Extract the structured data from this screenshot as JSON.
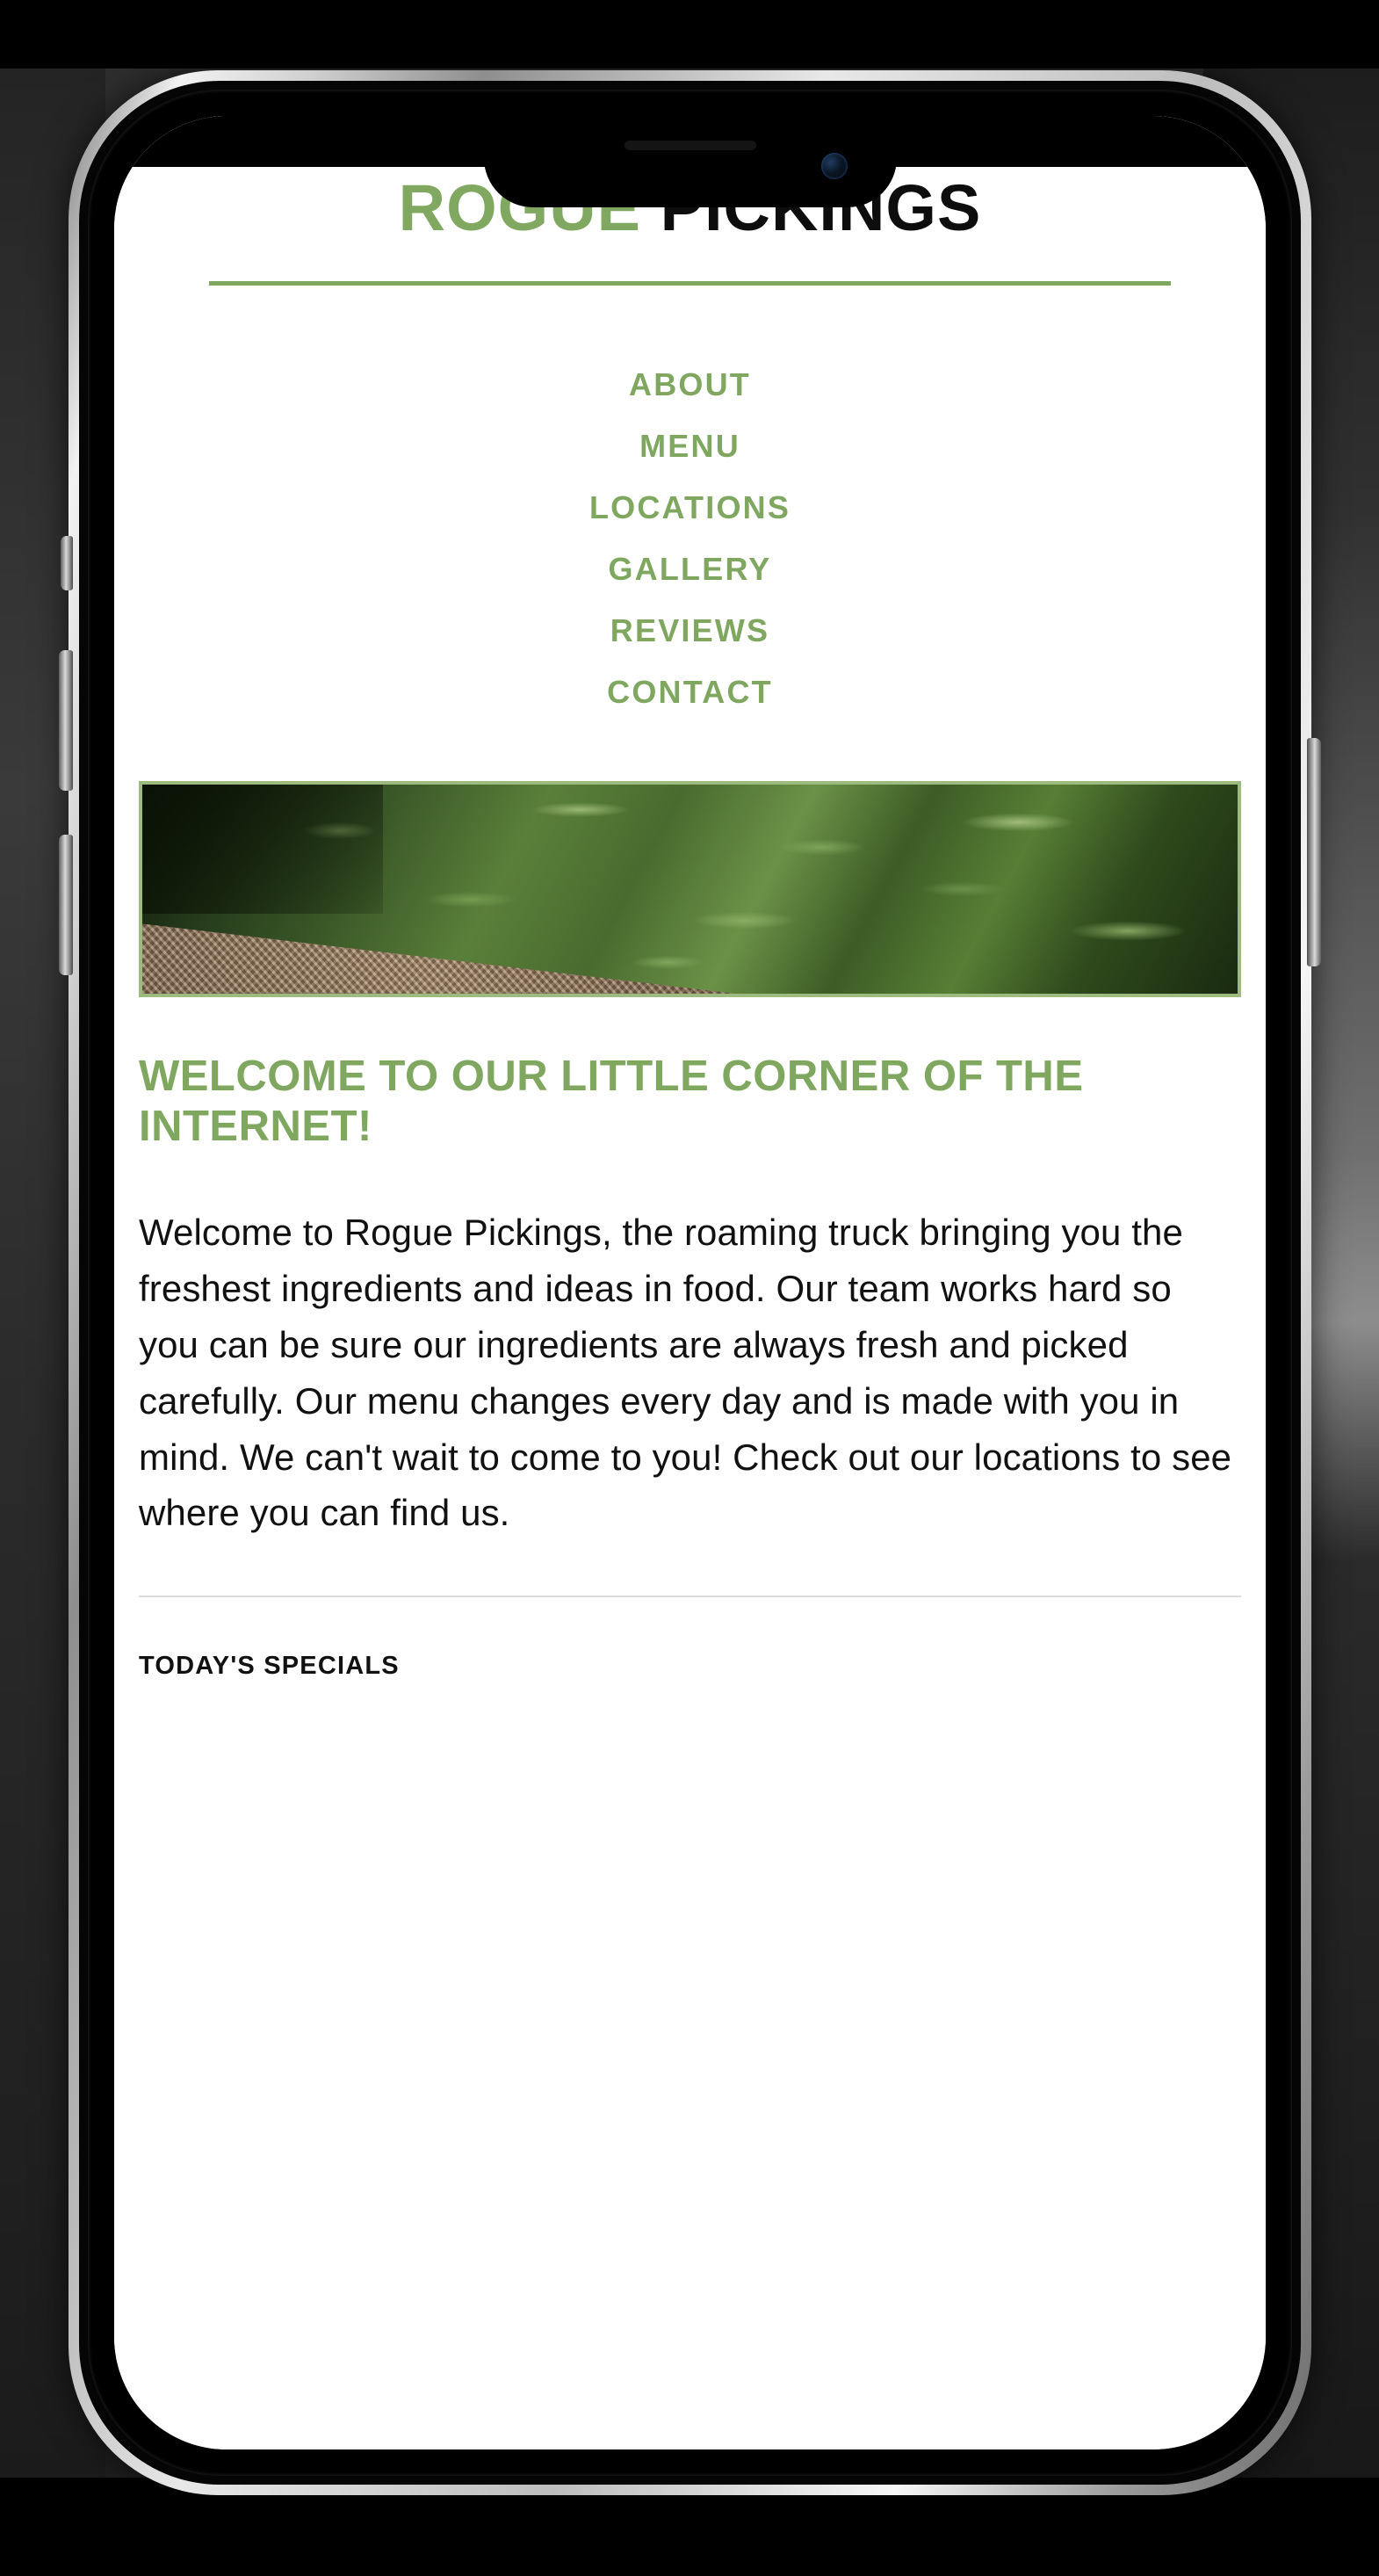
{
  "device": {
    "type": "smartphone-mockup",
    "buttons": [
      "silent-switch",
      "volume-up",
      "volume-down",
      "power"
    ]
  },
  "site": {
    "title_part_green": "ROGUE",
    "title_part_dark": " PICKINGS",
    "accent_color": "#7fa75f",
    "text_color": "#111111"
  },
  "nav": {
    "items": [
      {
        "label": "ABOUT"
      },
      {
        "label": "MENU"
      },
      {
        "label": "LOCATIONS"
      },
      {
        "label": "GALLERY"
      },
      {
        "label": "REVIEWS"
      },
      {
        "label": "CONTACT"
      }
    ]
  },
  "hero": {
    "alt": "close-up of fresh green beans in a woven basket",
    "border_color": "#9dbb7f"
  },
  "main": {
    "welcome_heading": "WELCOME TO OUR LITTLE CORNER OF THE INTERNET!",
    "welcome_body": "Welcome to Rogue Pickings, the roaming truck bringing you the freshest ingredients and ideas in food. Our team works hard so you can be sure our ingredients are always fresh and picked carefully. Our menu changes every day and is made with you in mind. We can't wait to come to you! Check out our locations to see where you can find us.",
    "specials_heading": "TODAY'S SPECIALS"
  }
}
